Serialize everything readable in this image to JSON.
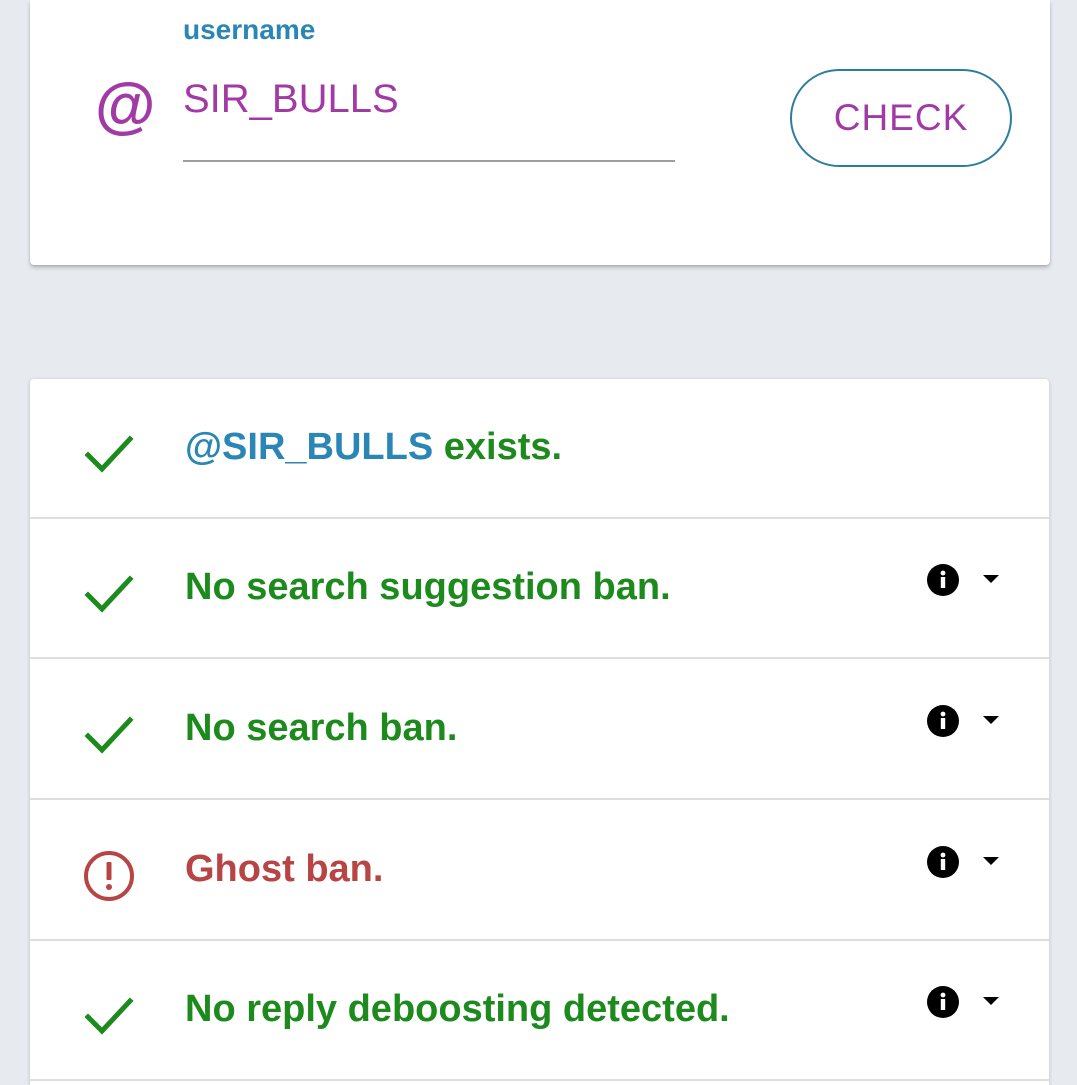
{
  "form": {
    "field_label": "username",
    "at_symbol": "@",
    "username_value": "SIR_BULLS",
    "check_label": "CHECK"
  },
  "results": [
    {
      "status": "ok",
      "icon": "check-icon",
      "handle": "@SIR_BULLS",
      "text": " exists.",
      "has_info": false
    },
    {
      "status": "ok",
      "icon": "check-icon",
      "text": "No search suggestion ban.",
      "has_info": true
    },
    {
      "status": "ok",
      "icon": "check-icon",
      "text": "No search ban.",
      "has_info": true
    },
    {
      "status": "bad",
      "icon": "alert-circle-icon",
      "text": "Ghost ban.",
      "has_info": true
    },
    {
      "status": "ok",
      "icon": "check-icon",
      "text": "No reply deboosting detected.",
      "has_info": true
    }
  ],
  "colors": {
    "ok": "#1d8a1d",
    "bad": "#b84545",
    "handle": "#2a86b5",
    "accent": "#a23aa6"
  }
}
